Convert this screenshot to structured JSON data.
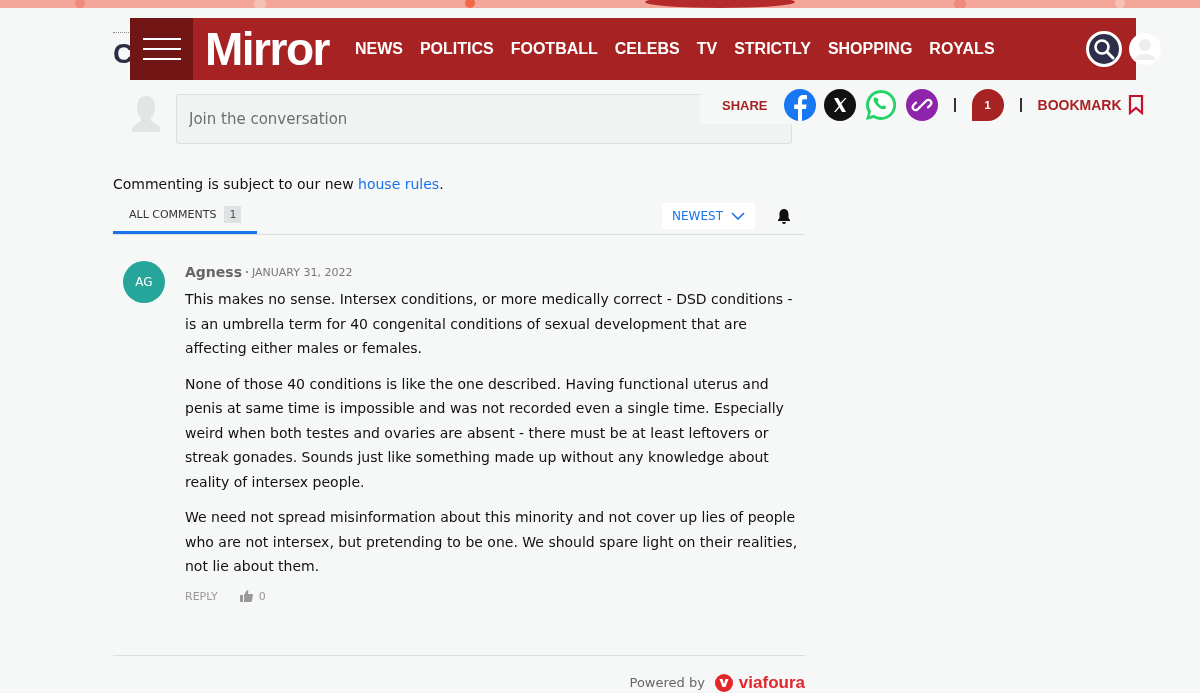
{
  "page_heading": "C",
  "header": {
    "logo": "Mirror",
    "nav": [
      "NEWS",
      "POLITICS",
      "FOOTBALL",
      "CELEBS",
      "TV",
      "STRICTLY",
      "SHOPPING",
      "ROYALS"
    ]
  },
  "share_bar": {
    "share_label": "SHARE",
    "comment_count": "1",
    "bookmark_label": "BOOKMARK"
  },
  "composer": {
    "placeholder": "Join the conversation"
  },
  "rules_note": {
    "text": "Commenting is subject to our new ",
    "link": "house rules",
    "end": "."
  },
  "tabs": [
    {
      "label": "ALL COMMENTS",
      "count": "1",
      "selected": true
    }
  ],
  "sort": {
    "label": "NEWEST"
  },
  "comments": [
    {
      "initials": "AG",
      "color": "#26a69a",
      "author": "Agness",
      "date": "JANUARY 31, 2022",
      "paragraphs": [
        "This makes no sense. Intersex conditions, or more medically correct - DSD conditions - is an umbrella term for 40 congenital conditions of sexual development that are affecting either males or females.",
        "None of those 40 conditions is like the one described. Having functional uterus and penis at same time is impossible and was not recorded even a single time. Especially weird when both testes and ovaries are absent - there must be at least leftovers or streak gonades. Sounds just like something made up without any knowledge about reality of intersex people.",
        "We need not spread misinformation about this minority and not cover up lies of people who are not intersex, but pretending to be one. We should spare light on their realities, not lie about them."
      ],
      "reply": "REPLY",
      "likes": "0"
    }
  ],
  "footer": {
    "powered_by": "Powered by",
    "brand": "viafoura"
  }
}
